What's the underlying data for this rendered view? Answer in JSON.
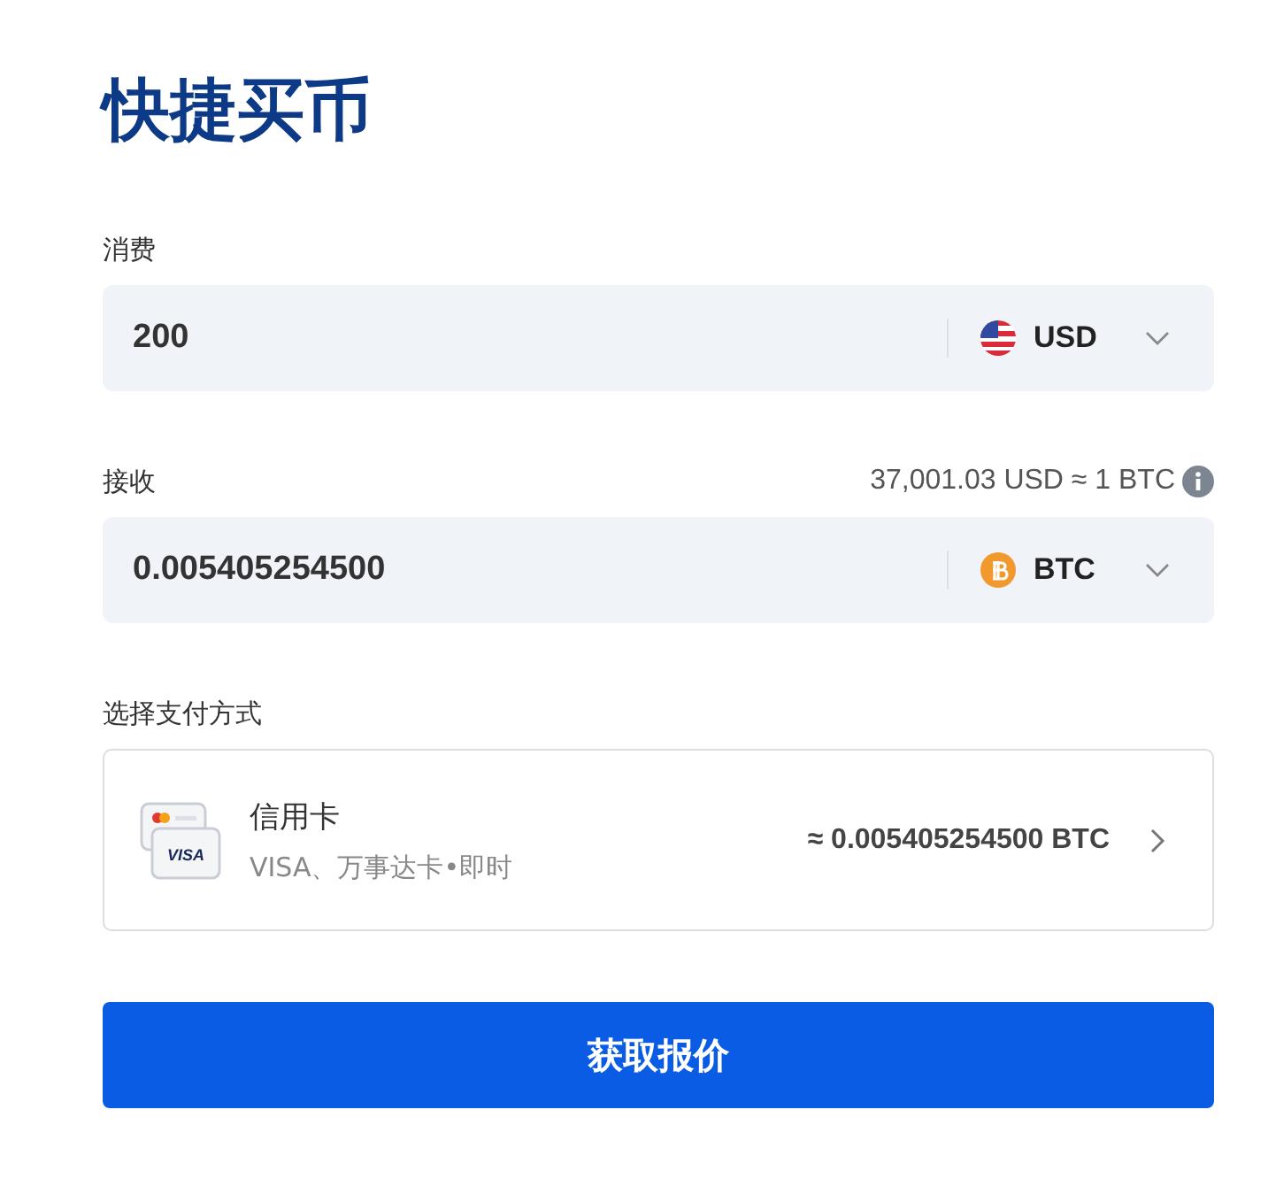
{
  "title": "快捷买币",
  "spend": {
    "label": "消费",
    "value": "200",
    "currency": "USD",
    "kind": "usd"
  },
  "receive": {
    "label": "接收",
    "rate": "37,001.03 USD ≈ 1 BTC",
    "value": "0.005405254500",
    "currency": "BTC",
    "kind": "btc"
  },
  "payment": {
    "label": "选择支付方式",
    "method": "信用卡",
    "icon_label": "VISA",
    "detail": "VISA、万事达卡•即时",
    "amount": "≈ 0.005405254500 BTC"
  },
  "button": "获取报价"
}
